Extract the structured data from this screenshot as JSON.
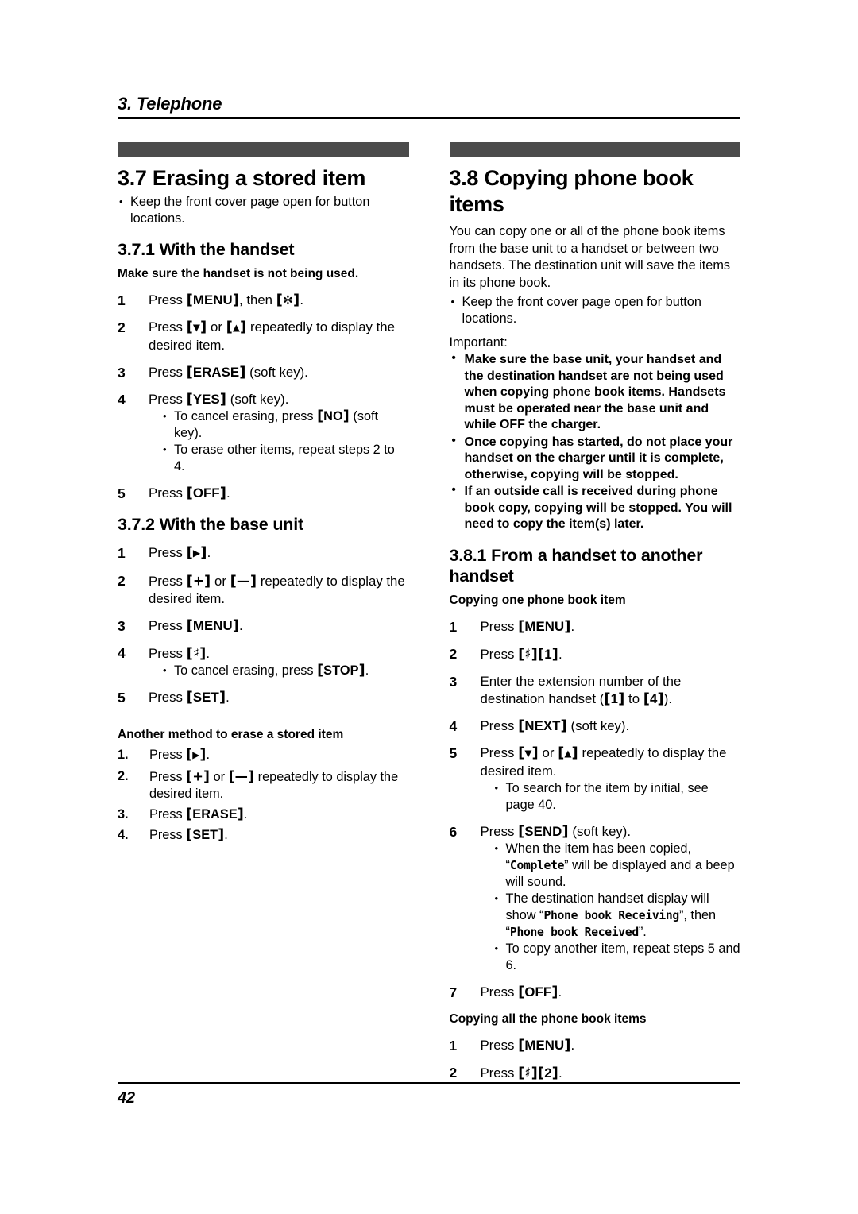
{
  "running_header": {
    "text": "3. Telephone"
  },
  "footer": {
    "page_number": "42"
  },
  "colors": {
    "section_bar": "#4b4b4b",
    "text": "#000000",
    "background": "#ffffff"
  },
  "left_column": {
    "section": {
      "number_title": "3.7 Erasing a stored item",
      "note_bullets": [
        "Keep the front cover page open for button locations."
      ]
    },
    "sub_3_7_1": {
      "title": "3.7.1 With the handset",
      "lead": "Make sure the handset is not being used.",
      "steps": [
        {
          "num": "1",
          "parts": [
            {
              "t": "text",
              "v": "Press "
            },
            {
              "t": "key",
              "v": "MENU"
            },
            {
              "t": "text",
              "v": ", then "
            },
            {
              "t": "keyglyph",
              "v": "✻",
              "name": "asterisk-key"
            },
            {
              "t": "text",
              "v": "."
            }
          ]
        },
        {
          "num": "2",
          "parts": [
            {
              "t": "text",
              "v": "Press "
            },
            {
              "t": "keyglyph",
              "v": "▼",
              "name": "down-arrow-key"
            },
            {
              "t": "text",
              "v": " or "
            },
            {
              "t": "keyglyph",
              "v": "▲",
              "name": "up-arrow-key"
            },
            {
              "t": "text",
              "v": " repeatedly to display the desired item."
            }
          ]
        },
        {
          "num": "3",
          "parts": [
            {
              "t": "text",
              "v": "Press "
            },
            {
              "t": "key",
              "v": "ERASE"
            },
            {
              "t": "text",
              "v": " (soft key)."
            }
          ]
        },
        {
          "num": "4",
          "parts": [
            {
              "t": "text",
              "v": "Press "
            },
            {
              "t": "key",
              "v": "YES"
            },
            {
              "t": "text",
              "v": " (soft key)."
            }
          ],
          "bullets": [
            [
              {
                "t": "text",
                "v": "To cancel erasing, press "
              },
              {
                "t": "key",
                "v": "NO"
              },
              {
                "t": "text",
                "v": " (soft key)."
              }
            ],
            [
              {
                "t": "text",
                "v": "To erase other items, repeat steps 2 to 4."
              }
            ]
          ]
        },
        {
          "num": "5",
          "parts": [
            {
              "t": "text",
              "v": "Press "
            },
            {
              "t": "key",
              "v": "OFF"
            },
            {
              "t": "text",
              "v": "."
            }
          ]
        }
      ]
    },
    "sub_3_7_2": {
      "title": "3.7.2 With the base unit",
      "steps": [
        {
          "num": "1",
          "parts": [
            {
              "t": "text",
              "v": "Press "
            },
            {
              "t": "keyglyph",
              "v": "▶",
              "name": "right-arrow-key"
            },
            {
              "t": "text",
              "v": "."
            }
          ]
        },
        {
          "num": "2",
          "parts": [
            {
              "t": "text",
              "v": "Press "
            },
            {
              "t": "keyglyph",
              "v": "+",
              "name": "plus-key"
            },
            {
              "t": "text",
              "v": " or "
            },
            {
              "t": "keyglyph",
              "v": "—",
              "name": "minus-key"
            },
            {
              "t": "text",
              "v": " repeatedly to display the desired item."
            }
          ]
        },
        {
          "num": "3",
          "parts": [
            {
              "t": "text",
              "v": "Press "
            },
            {
              "t": "key",
              "v": "MENU"
            },
            {
              "t": "text",
              "v": "."
            }
          ]
        },
        {
          "num": "4",
          "parts": [
            {
              "t": "text",
              "v": "Press "
            },
            {
              "t": "keyglyph",
              "v": "♯",
              "name": "hash-key"
            },
            {
              "t": "text",
              "v": "."
            }
          ],
          "bullets": [
            [
              {
                "t": "text",
                "v": "To cancel erasing, press "
              },
              {
                "t": "key",
                "v": "STOP"
              },
              {
                "t": "text",
                "v": "."
              }
            ]
          ]
        },
        {
          "num": "5",
          "parts": [
            {
              "t": "text",
              "v": "Press "
            },
            {
              "t": "key",
              "v": "SET"
            },
            {
              "t": "text",
              "v": "."
            }
          ]
        }
      ]
    },
    "another_method": {
      "title": "Another method to erase a stored item",
      "steps": [
        {
          "num": "1.",
          "parts": [
            {
              "t": "text",
              "v": "Press "
            },
            {
              "t": "keyglyph",
              "v": "▶",
              "name": "right-arrow-key"
            },
            {
              "t": "text",
              "v": "."
            }
          ]
        },
        {
          "num": "2.",
          "parts": [
            {
              "t": "text",
              "v": "Press "
            },
            {
              "t": "keyglyph",
              "v": "+",
              "name": "plus-key"
            },
            {
              "t": "text",
              "v": " or "
            },
            {
              "t": "keyglyph",
              "v": "—",
              "name": "minus-key"
            },
            {
              "t": "text",
              "v": " repeatedly to display the desired item."
            }
          ]
        },
        {
          "num": "3.",
          "parts": [
            {
              "t": "text",
              "v": "Press "
            },
            {
              "t": "key",
              "v": "ERASE"
            },
            {
              "t": "text",
              "v": "."
            }
          ]
        },
        {
          "num": "4.",
          "parts": [
            {
              "t": "text",
              "v": "Press "
            },
            {
              "t": "key",
              "v": "SET"
            },
            {
              "t": "text",
              "v": "."
            }
          ]
        }
      ]
    }
  },
  "right_column": {
    "section": {
      "number_title": "3.8 Copying phone book items",
      "intro": "You can copy one or all of the phone book items from the base unit to a handset or between two handsets. The destination unit will save the items in its phone book.",
      "note_bullets": [
        "Keep the front cover page open for button locations."
      ],
      "important_label": "Important:",
      "important_bullets": [
        "Make sure the base unit, your handset and the destination handset are not being used when copying phone book items. Handsets must be operated near the base unit and while OFF the charger.",
        "Once copying has started, do not place your handset on the charger until it is complete, otherwise, copying will be stopped.",
        "If an outside call is received during phone book copy, copying will be stopped. You will need to copy the item(s) later."
      ]
    },
    "sub_3_8_1": {
      "title": "3.8.1 From a handset to another handset",
      "group_one": {
        "heading": "Copying one phone book item",
        "steps": [
          {
            "num": "1",
            "parts": [
              {
                "t": "text",
                "v": "Press "
              },
              {
                "t": "key",
                "v": "MENU"
              },
              {
                "t": "text",
                "v": "."
              }
            ]
          },
          {
            "num": "2",
            "parts": [
              {
                "t": "text",
                "v": "Press "
              },
              {
                "t": "keyglyph",
                "v": "♯",
                "name": "hash-key"
              },
              {
                "t": "key",
                "v": "1"
              },
              {
                "t": "text",
                "v": "."
              }
            ]
          },
          {
            "num": "3",
            "parts": [
              {
                "t": "text",
                "v": "Enter the extension number of the destination handset ("
              },
              {
                "t": "key",
                "v": "1"
              },
              {
                "t": "text",
                "v": " to "
              },
              {
                "t": "key",
                "v": "4"
              },
              {
                "t": "text",
                "v": ")."
              }
            ]
          },
          {
            "num": "4",
            "parts": [
              {
                "t": "text",
                "v": "Press "
              },
              {
                "t": "key",
                "v": "NEXT"
              },
              {
                "t": "text",
                "v": " (soft key)."
              }
            ]
          },
          {
            "num": "5",
            "parts": [
              {
                "t": "text",
                "v": "Press "
              },
              {
                "t": "keyglyph",
                "v": "▼",
                "name": "down-arrow-key"
              },
              {
                "t": "text",
                "v": " or "
              },
              {
                "t": "keyglyph",
                "v": "▲",
                "name": "up-arrow-key"
              },
              {
                "t": "text",
                "v": " repeatedly to display the desired item."
              }
            ],
            "bullets": [
              [
                {
                  "t": "text",
                  "v": "To search for the item by initial, see page 40."
                }
              ]
            ]
          },
          {
            "num": "6",
            "parts": [
              {
                "t": "text",
                "v": "Press "
              },
              {
                "t": "key",
                "v": "SEND"
              },
              {
                "t": "text",
                "v": " (soft key)."
              }
            ],
            "bullets": [
              [
                {
                  "t": "text",
                  "v": " When the item has been copied, “"
                },
                {
                  "t": "mono",
                  "v": "Complete"
                },
                {
                  "t": "text",
                  "v": "” will be displayed and a beep will sound."
                }
              ],
              [
                {
                  "t": "text",
                  "v": "The destination handset display will show “"
                },
                {
                  "t": "mono",
                  "v": "Phone book Receiving"
                },
                {
                  "t": "text",
                  "v": "”, then “"
                },
                {
                  "t": "mono",
                  "v": "Phone book Received"
                },
                {
                  "t": "text",
                  "v": "”."
                }
              ],
              [
                {
                  "t": "text",
                  "v": "To copy another item, repeat steps 5 and 6."
                }
              ]
            ]
          },
          {
            "num": "7",
            "parts": [
              {
                "t": "text",
                "v": "Press "
              },
              {
                "t": "key",
                "v": "OFF"
              },
              {
                "t": "text",
                "v": "."
              }
            ]
          }
        ]
      },
      "group_all": {
        "heading": "Copying all the phone book items",
        "steps": [
          {
            "num": "1",
            "parts": [
              {
                "t": "text",
                "v": "Press "
              },
              {
                "t": "key",
                "v": "MENU"
              },
              {
                "t": "text",
                "v": "."
              }
            ]
          },
          {
            "num": "2",
            "parts": [
              {
                "t": "text",
                "v": "Press "
              },
              {
                "t": "keyglyph",
                "v": "♯",
                "name": "hash-key"
              },
              {
                "t": "key",
                "v": "2"
              },
              {
                "t": "text",
                "v": "."
              }
            ]
          }
        ]
      }
    }
  }
}
